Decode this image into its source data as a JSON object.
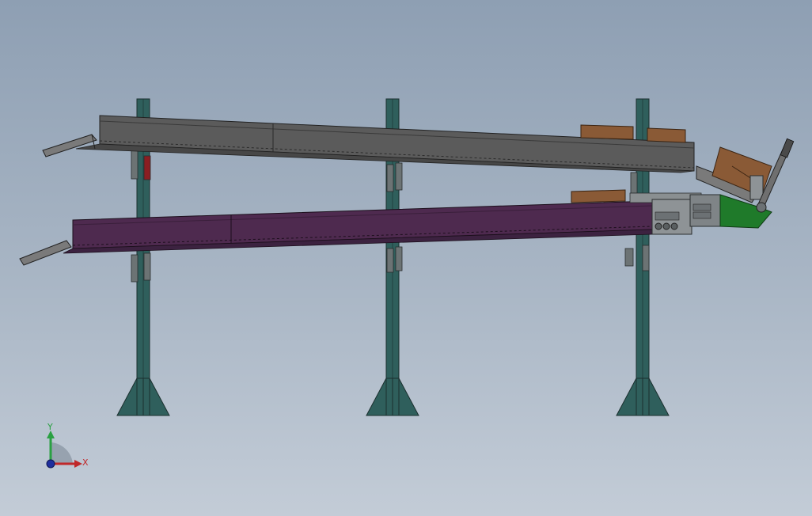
{
  "colors": {
    "background_top": "#8e9fb3",
    "background_bottom": "#c3ccd7",
    "column": "#2f5f5c",
    "upper_conveyor": "#5b5b5b",
    "lower_conveyor": "#4e2a4f",
    "box": "#8a5a36",
    "transfer_unit_green": "#1f7a2a",
    "axis_x": "#c0282a",
    "axis_y": "#2aa042",
    "axis_origin": "#1f2f9e"
  },
  "triad": {
    "x_label": "X",
    "y_label": "Y"
  }
}
